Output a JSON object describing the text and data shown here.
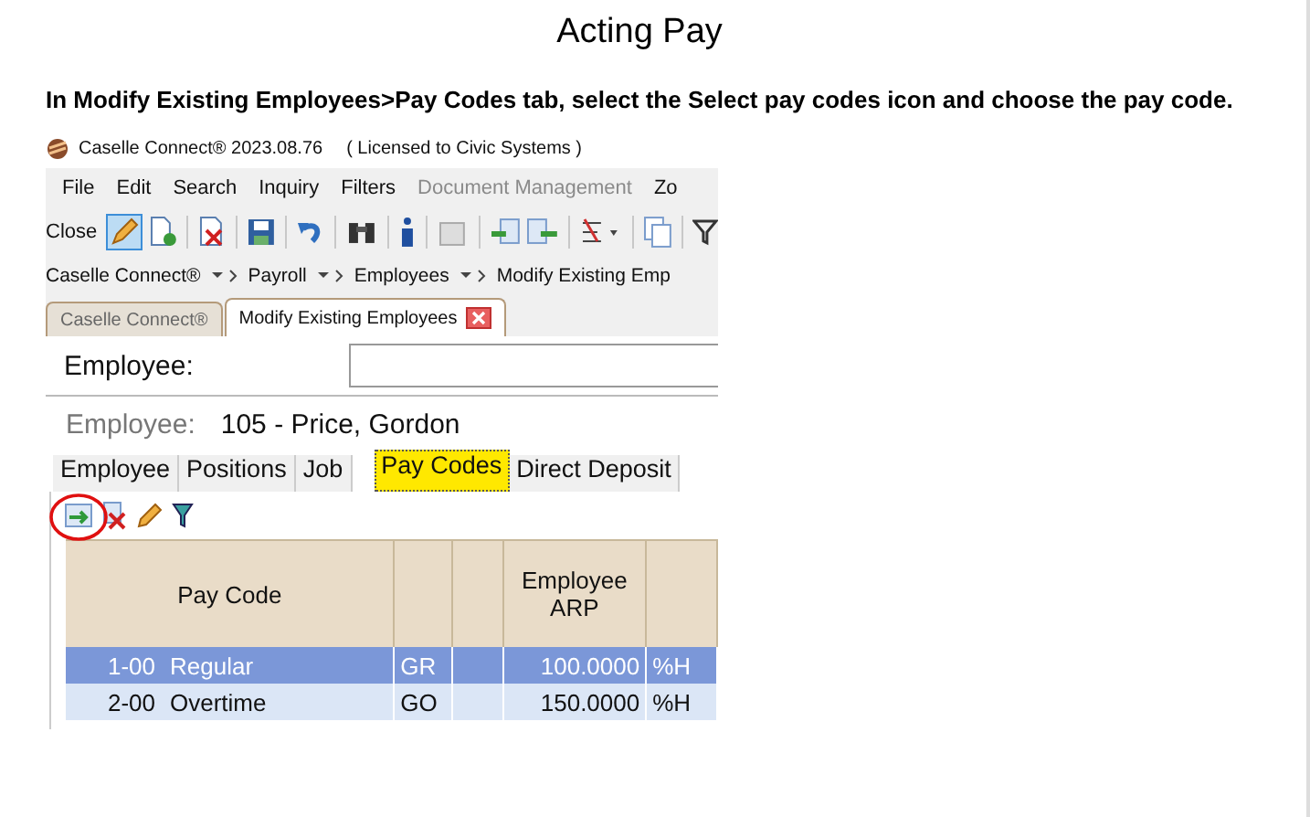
{
  "page": {
    "title": "Acting Pay",
    "instruction": "In Modify Existing Employees>Pay Codes tab, select the Select pay codes icon and choose the pay code."
  },
  "app": {
    "title": "Caselle Connect® 2023.08.76",
    "license": "( Licensed to Civic Systems )",
    "menu": [
      {
        "label": "File",
        "disabled": false
      },
      {
        "label": "Edit",
        "disabled": false
      },
      {
        "label": "Search",
        "disabled": false
      },
      {
        "label": "Inquiry",
        "disabled": false
      },
      {
        "label": "Filters",
        "disabled": false
      },
      {
        "label": "Document Management",
        "disabled": true
      },
      {
        "label": "Zo",
        "disabled": false
      }
    ],
    "toolbar_label": "Close",
    "breadcrumbs": [
      "Caselle Connect®",
      "Payroll",
      "Employees",
      "Modify Existing Emp"
    ],
    "doc_tabs": [
      {
        "label": "Caselle Connect®",
        "selected": false
      },
      {
        "label": "Modify Existing Employees",
        "selected": true
      }
    ],
    "employee_field": {
      "label": "Employee:"
    },
    "employee_info": {
      "label": "Employee:",
      "value": "105 - Price, Gordon"
    },
    "tabs": [
      {
        "label": "Employee",
        "selected": false
      },
      {
        "label": "Positions",
        "selected": false
      },
      {
        "label": "Job",
        "selected": false
      },
      {
        "label": "Pay Codes",
        "selected": true
      },
      {
        "label": "Direct Deposit",
        "selected": false
      }
    ],
    "grid": {
      "columns": [
        "Pay Code",
        "Employee ARP"
      ],
      "rows": [
        {
          "code": "1-00",
          "name": "Regular",
          "type": "GR",
          "arp": "100.0000",
          "unit": "%H",
          "selected": true
        },
        {
          "code": "2-00",
          "name": "Overtime",
          "type": "GO",
          "arp": "150.0000",
          "unit": "%H",
          "selected": false
        }
      ]
    }
  }
}
